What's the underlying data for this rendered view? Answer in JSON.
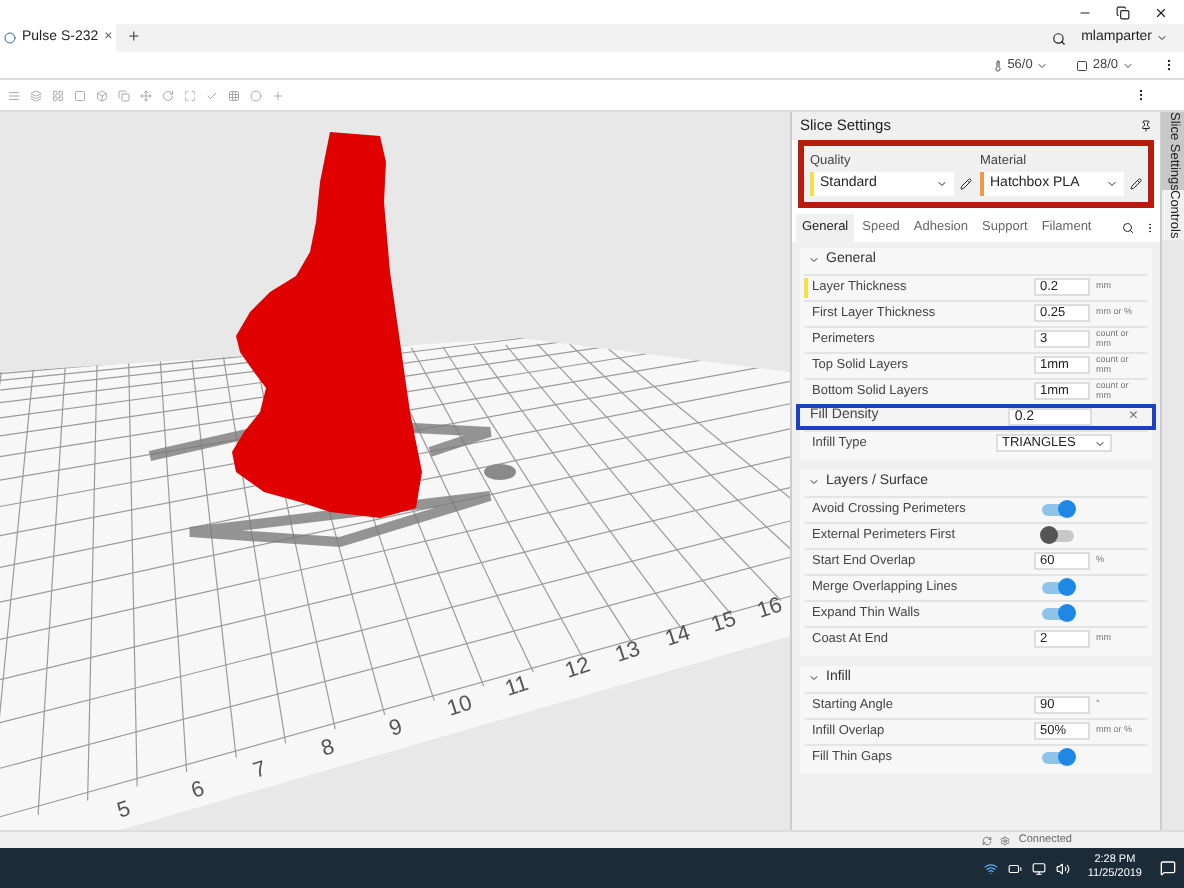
{
  "tab": {
    "title": "Pulse S-232",
    "close": "×",
    "add": "+"
  },
  "user": {
    "name": "mlamparter"
  },
  "counters": [
    {
      "value": "56/0"
    },
    {
      "value": "28/0"
    }
  ],
  "bed_labels": [
    "5",
    "6",
    "7",
    "8",
    "9",
    "10",
    "11",
    "12",
    "13",
    "14",
    "15",
    "16"
  ],
  "panel": {
    "title": "Slice Settings",
    "quality": {
      "label": "Quality",
      "value": "Standard"
    },
    "material": {
      "label": "Material",
      "value": "Hatchbox PLA"
    },
    "tabs": [
      {
        "label": "General",
        "selected": true
      },
      {
        "label": "Speed",
        "selected": false
      },
      {
        "label": "Adhesion",
        "selected": false
      },
      {
        "label": "Support",
        "selected": false
      },
      {
        "label": "Filament",
        "selected": false
      }
    ],
    "sections": [
      {
        "title": "General",
        "expanded": true,
        "rows": [
          {
            "kind": "input",
            "label": "Layer Thickness",
            "value": "0.2",
            "unit": "mm",
            "modified": true
          },
          {
            "kind": "input",
            "label": "First Layer Thickness",
            "value": "0.25",
            "unit": "mm or %",
            "modified": false
          },
          {
            "kind": "input",
            "label": "Perimeters",
            "value": "3",
            "unit": "count or mm",
            "modified": false
          },
          {
            "kind": "input",
            "label": "Top Solid Layers",
            "value": "1mm",
            "unit": "count or mm",
            "modified": false
          },
          {
            "kind": "input",
            "label": "Bottom Solid Layers",
            "value": "1mm",
            "unit": "count or mm",
            "modified": false
          },
          {
            "kind": "highlight",
            "label": "Fill Density",
            "value": "0.2",
            "clear": "×"
          },
          {
            "kind": "select",
            "label": "Infill Type",
            "value": "TRIANGLES"
          }
        ]
      },
      {
        "title": "Layers / Surface",
        "expanded": true,
        "rows": [
          {
            "kind": "toggle",
            "label": "Avoid Crossing Perimeters",
            "on": true
          },
          {
            "kind": "toggle",
            "label": "External Perimeters First",
            "on": false
          },
          {
            "kind": "input",
            "label": "Start End Overlap",
            "value": "60",
            "unit": "%",
            "modified": false
          },
          {
            "kind": "toggle",
            "label": "Merge Overlapping Lines",
            "on": true
          },
          {
            "kind": "toggle",
            "label": "Expand Thin Walls",
            "on": true
          },
          {
            "kind": "input",
            "label": "Coast At End",
            "value": "2",
            "unit": "mm",
            "modified": false
          }
        ]
      },
      {
        "title": "Infill",
        "expanded": true,
        "rows": [
          {
            "kind": "input",
            "label": "Starting Angle",
            "value": "90",
            "unit": "°",
            "modified": false
          },
          {
            "kind": "input",
            "label": "Infill Overlap",
            "value": "50%",
            "unit": "mm or %",
            "modified": false
          },
          {
            "kind": "toggle",
            "label": "Fill Thin Gaps",
            "on": true
          }
        ]
      }
    ]
  },
  "side_tabs": [
    {
      "label": "Slice Settings",
      "selected": true
    },
    {
      "label": "Controls",
      "selected": false
    }
  ],
  "status": {
    "text": "Connected"
  },
  "clock": {
    "time": "2:28 PM",
    "date": "11/25/2019"
  }
}
